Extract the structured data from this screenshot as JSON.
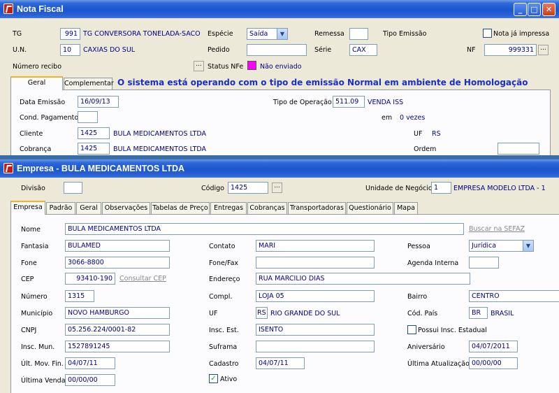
{
  "win1": {
    "title": "Nota Fiscal",
    "btn_min": "_",
    "btn_max": "□",
    "btn_close": "✕",
    "tg_label": "TG",
    "tg_code": "991",
    "tg_name": "TG CONVERSORA TONELADA-SACO",
    "un_label": "U.N.",
    "un_code": "10",
    "un_name": "CAXIAS DO SUL",
    "numero_recibo_label": "Número recibo",
    "especie_label": "Espécie",
    "especie_value": "Saída",
    "pedido_label": "Pedido",
    "pedido_value": "",
    "status_label": "Status NFe",
    "status_value": "Não enviado",
    "status_color": "#ff00ff",
    "remessa_label": "Remessa",
    "remessa_value": "",
    "serie_label": "Série",
    "serie_value": "CAX",
    "tipo_emissao_label": "Tipo Emissão",
    "nota_impressa_label": "Nota já impressa",
    "nf_label": "NF",
    "nf_value": "999331",
    "dots": "...",
    "tabs": [
      "Geral",
      "Complementar"
    ],
    "banner": "O sistema está operando com o tipo de emissão Normal em ambiente de Homologação",
    "data_emissao_label": "Data Emissão",
    "data_emissao_value": "16/09/13",
    "cond_pag_label": "Cond. Pagamento",
    "cond_pag_value": "",
    "cliente_label": "Cliente",
    "cliente_code": "1425",
    "cliente_name": "BULA MEDICAMENTOS LTDA",
    "cobranca_label": "Cobrança",
    "cobranca_code": "1425",
    "cobranca_name": "BULA MEDICAMENTOS LTDA",
    "tipo_op_label": "Tipo de Operação",
    "tipo_op_code": "511.09",
    "tipo_op_name": "VENDA ISS",
    "em_label": "em",
    "em_value": "0 vezes",
    "uf_label": "UF",
    "uf_value": "RS",
    "ordem_label": "Ordem",
    "ordem_value": ""
  },
  "win2": {
    "title": "Empresa - BULA MEDICAMENTOS LTDA",
    "divisao_label": "Divisão",
    "divisao_value": "",
    "codigo_label": "Código",
    "codigo_value": "1425",
    "unidade_label": "Unidade de Negócio",
    "unidade_code": "1",
    "unidade_name": "EMPRESA MODELO LTDA - 1",
    "dots": "...",
    "tabs": [
      "Empresa",
      "Padrão",
      "Geral",
      "Observações",
      "Tabelas de Preço",
      "Entregas",
      "Cobranças",
      "Transportadoras",
      "Questionário",
      "Mapa"
    ],
    "nome_label": "Nome",
    "nome_value": "BULA MEDICAMENTOS LTDA",
    "buscar_sefaz": "Buscar na SEFAZ",
    "fantasia_label": "Fantasia",
    "fantasia_value": "BULAMED",
    "fone_label": "Fone",
    "fone_value": "3066-8800",
    "cep_label": "CEP",
    "cep_value": "93410-190",
    "consultar_cep": "Consultar CEP",
    "numero_label": "Número",
    "numero_value": "1315",
    "municipio_label": "Município",
    "municipio_value": "NOVO HAMBURGO",
    "cnpj_label": "CNPJ",
    "cnpj_value": "05.256.224/0001-82",
    "insc_mun_label": "Insc. Mun.",
    "insc_mun_value": "1527891245",
    "ult_mov_label": "Últ. Mov. Fin.",
    "ult_mov_value": "04/07/11",
    "ultima_venda_label": "Última Venda",
    "ultima_venda_value": "00/00/00",
    "contato_label": "Contato",
    "contato_value": "MARI",
    "fonefax_label": "Fone/Fax",
    "fonefax_value": "",
    "endereco_label": "Endereço",
    "endereco_value": "RUA MARCILIO DIAS",
    "compl_label": "Compl.",
    "compl_value": "LOJA 05",
    "uf_label": "UF",
    "uf_code": "RS",
    "uf_name": "RIO GRANDE DO SUL",
    "insc_est_label": "Insc. Est.",
    "insc_est_value": "ISENTO",
    "suframa_label": "Suframa",
    "suframa_value": "",
    "cadastro_label": "Cadastro",
    "cadastro_value": "04/07/11",
    "ativo_label": "Ativo",
    "pessoa_label": "Pessoa",
    "pessoa_value": "Jurídica",
    "agenda_label": "Agenda Interna",
    "agenda_value": "",
    "bairro_label": "Bairro",
    "bairro_value": "CENTRO",
    "cod_pais_label": "Cód. País",
    "cod_pais_code": "BR",
    "cod_pais_name": "BRASIL",
    "possui_insc_label": "Possui Insc. Estadual",
    "aniversario_label": "Aniversário",
    "aniversario_value": "04/07/2011",
    "ultima_atualizacao_label": "Última Atualização",
    "ultima_atualizacao_value": "00/00/00",
    "arrow": "▼",
    "check": "✓"
  }
}
